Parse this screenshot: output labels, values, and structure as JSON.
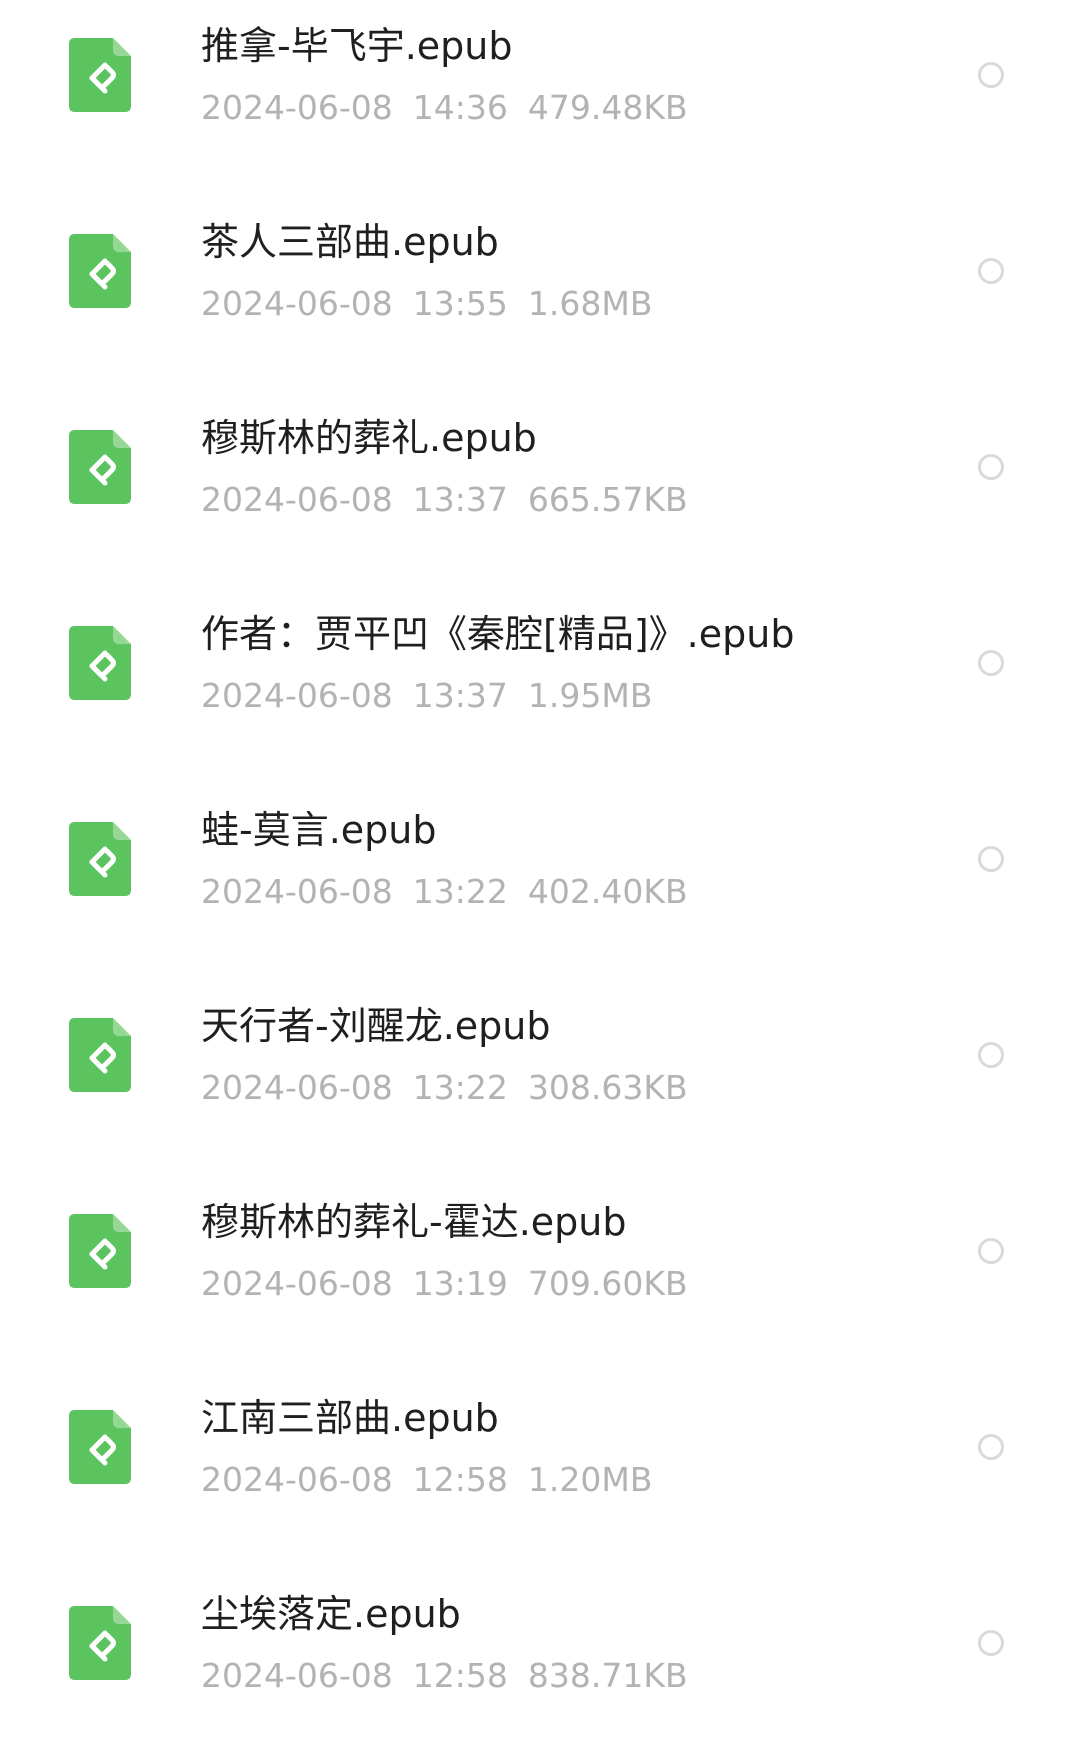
{
  "colors": {
    "icon_green": "#5cc45e",
    "name_text": "#1f1f1f",
    "meta_text": "#b3b3b3",
    "radio_border": "#d9d9d9"
  },
  "files": [
    {
      "name": "推拿-毕飞宇.epub",
      "date": "2024-06-08",
      "time": "14:36",
      "size": "479.48KB",
      "icon": "epub-file-icon",
      "selected": false
    },
    {
      "name": "茶人三部曲.epub",
      "date": "2024-06-08",
      "time": "13:55",
      "size": "1.68MB",
      "icon": "epub-file-icon",
      "selected": false
    },
    {
      "name": "穆斯林的葬礼.epub",
      "date": "2024-06-08",
      "time": "13:37",
      "size": "665.57KB",
      "icon": "epub-file-icon",
      "selected": false
    },
    {
      "name": "作者：贾平凹《秦腔[精品]》.epub",
      "date": "2024-06-08",
      "time": "13:37",
      "size": "1.95MB",
      "icon": "epub-file-icon",
      "selected": false
    },
    {
      "name": "蛙-莫言.epub",
      "date": "2024-06-08",
      "time": "13:22",
      "size": "402.40KB",
      "icon": "epub-file-icon",
      "selected": false
    },
    {
      "name": "天行者-刘醒龙.epub",
      "date": "2024-06-08",
      "time": "13:22",
      "size": "308.63KB",
      "icon": "epub-file-icon",
      "selected": false
    },
    {
      "name": "穆斯林的葬礼-霍达.epub",
      "date": "2024-06-08",
      "time": "13:19",
      "size": "709.60KB",
      "icon": "epub-file-icon",
      "selected": false
    },
    {
      "name": "江南三部曲.epub",
      "date": "2024-06-08",
      "time": "12:58",
      "size": "1.20MB",
      "icon": "epub-file-icon",
      "selected": false
    },
    {
      "name": "尘埃落定.epub",
      "date": "2024-06-08",
      "time": "12:58",
      "size": "838.71KB",
      "icon": "epub-file-icon",
      "selected": false
    }
  ]
}
